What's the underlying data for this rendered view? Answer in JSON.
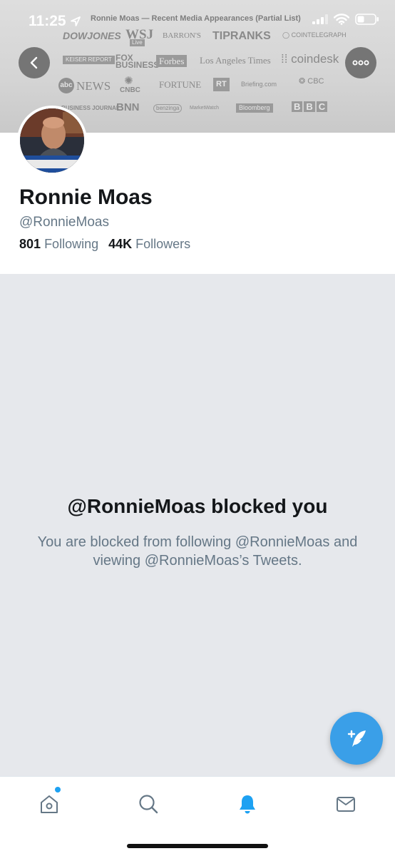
{
  "status_bar": {
    "time": "11:25"
  },
  "banner": {
    "title": "Ronnie Moas — Recent Media Appearances (Partial List)",
    "logos": {
      "dowjones": "DOWJONES",
      "wsj": "WSJ",
      "wsj_sub": "Live",
      "barrons": "BARRON'S",
      "tipranks": "TIPRANKS",
      "cointelegraph": "COINTELEGRAPH",
      "keiser": "KEISER REPORT",
      "foxbusiness": "FOX BUSINESS",
      "forbes": "Forbes",
      "latimes": "Los Angeles Times",
      "coindesk": "coindesk",
      "abcnews": "NEWS",
      "abc": "abc",
      "cnbc": "CNBC",
      "fortune": "FORTUNE",
      "rt": "RT",
      "briefing": "Briefing.com",
      "cbc": "CBC",
      "sfbj": "BUSINESS JOURNAL",
      "bnn": "BNN",
      "benzinga": "benzinga",
      "marketwatch": "MarketWatch",
      "bloomberg": "Bloomberg",
      "bbc_b1": "B",
      "bbc_b2": "B",
      "bbc_c": "C"
    }
  },
  "header": {
    "back_icon": "chevron-left-icon",
    "more_icon": "more-horizontal-icon"
  },
  "profile": {
    "name": "Ronnie Moas",
    "handle": "@RonnieMoas",
    "following_count": "801",
    "following_label": "Following",
    "followers_count": "44K",
    "followers_label": "Followers"
  },
  "blocked": {
    "title": "@RonnieMoas blocked you",
    "message": "You are blocked from following @RonnieMoas and viewing @RonnieMoas’s Tweets."
  },
  "fab": {
    "icon": "compose-tweet-icon"
  },
  "tabbar": {
    "items": [
      {
        "icon": "home-icon"
      },
      {
        "icon": "search-icon"
      },
      {
        "icon": "notifications-bell-icon"
      },
      {
        "icon": "messages-envelope-icon"
      }
    ]
  },
  "colors": {
    "accent": "#1da1f2",
    "fab": "#3a9fe8",
    "text_primary": "#14171a",
    "text_secondary": "#657786",
    "background": "#e6e8ec"
  }
}
